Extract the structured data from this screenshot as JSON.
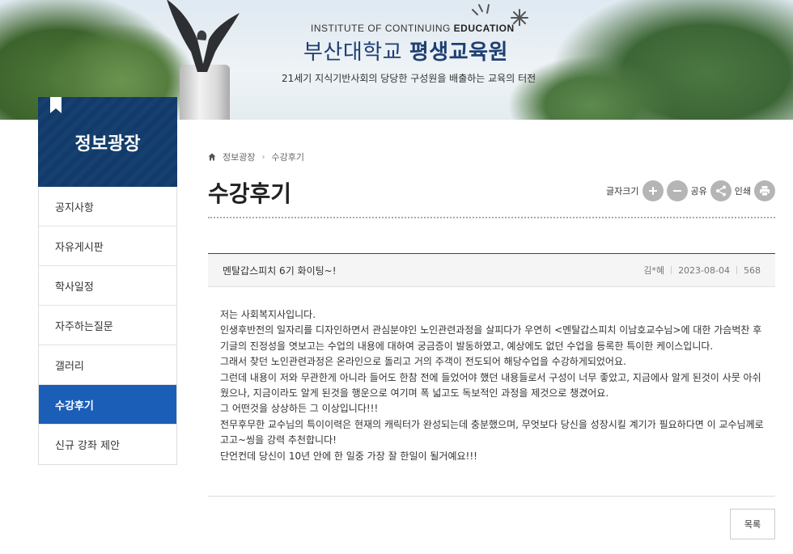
{
  "banner": {
    "subtitle_en_prefix": "INSTITUTE OF CONTINUING ",
    "subtitle_en_bold": "EDUCATION",
    "title_prefix": "부산대학교 ",
    "title_bold": "평생교육원",
    "slogan": "21세기 지식기반사회의 당당한 구성원을 배출하는 교육의 터전"
  },
  "sidebar": {
    "title": "정보광장",
    "items": [
      {
        "label": "공지사항"
      },
      {
        "label": "자유게시판"
      },
      {
        "label": "학사일정"
      },
      {
        "label": "자주하는질문"
      },
      {
        "label": "갤러리"
      },
      {
        "label": "수강후기",
        "active": true
      },
      {
        "label": "신규 강좌 제안"
      }
    ]
  },
  "breadcrumb": {
    "items": [
      "정보광장",
      "수강후기"
    ]
  },
  "page": {
    "title": "수강후기"
  },
  "tools": {
    "font_size_label": "글자크기",
    "share_label": "공유",
    "print_label": "인쇄"
  },
  "post": {
    "title": "멘탈갑스피치 6기 화이팅~!",
    "author": "김*혜",
    "date": "2023-08-04",
    "views": "568",
    "body": [
      "저는 사회복지사입니다.",
      "인생후반전의 일자리를 디자인하면서 관심분야인 노인관련과정을 살피다가 우연히 <멘탈갑스피치 이남호교수님>에 대한 가슴벅찬 후기글의 진정성을 엿보고는 수업의 내용에 대하여 궁금증이 발동하였고, 예상에도 없던 수업을 등록한 특이한 케이스입니다.",
      "그래서 찾던 노인관련과정은 온라인으로 돌리고 거의 주객이 전도되어 해당수업을 수강하게되었어요.",
      "그런데 내용이 저와 무관한게 아니라 들어도 한참 전에 들었어야 했던 내용들로서 구성이 너무 좋았고, 지금에사 알게 된것이 사뭇 아쉬웠으나, 지금이라도 알게 된것을 행운으로 여기며 폭 넓고도 독보적인 과정을 제것으로 챙겼어요.",
      "그 어떤것을 상상하든 그 이상입니다!!!",
      "전무후무한 교수님의 특이이력은 현재의 캐릭터가 완성되는데 충분했으며, 무엇보다 당신을 성장시킬 계기가 필요하다면 이 교수님께로 고고~씽을 강력 추천합니다!",
      "단언컨데 당신이 10년 안에 한 일중 가장 잘 한일이 될거예요!!!"
    ]
  },
  "list_button": {
    "label": "목록"
  },
  "colors": {
    "accent": "#1b5eb8",
    "sidebar_head": "#123a6a",
    "title_blue": "#1f3f72"
  }
}
